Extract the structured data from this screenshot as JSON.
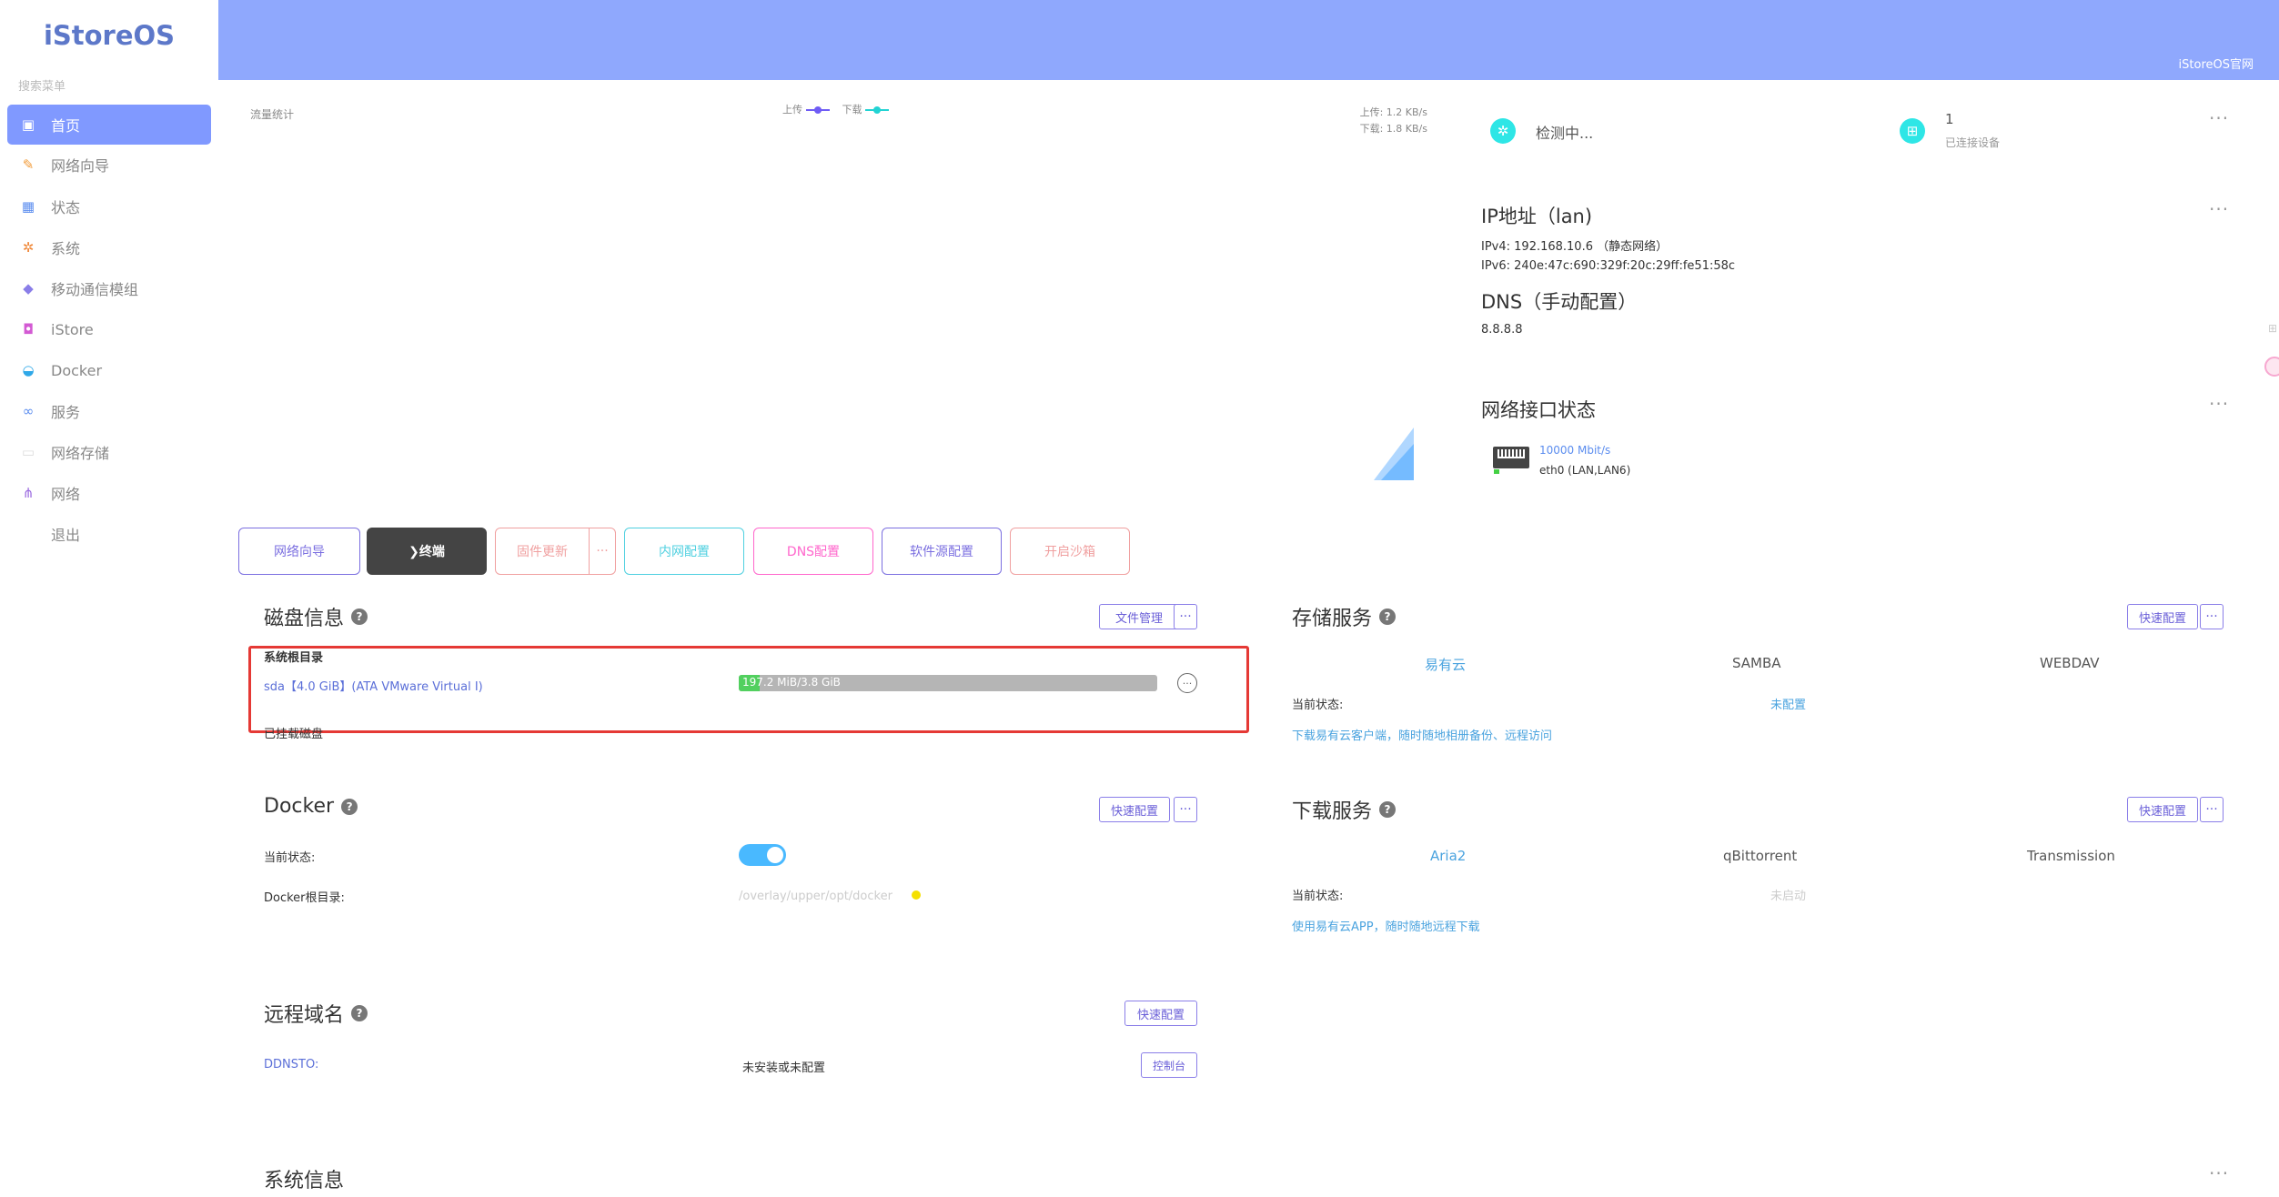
{
  "app": {
    "logo": "iStoreOS",
    "search_hint": "搜索菜单",
    "header_link": "iStoreOS官网"
  },
  "sidebar": {
    "items": [
      {
        "label": "首页",
        "icon": "home-icon",
        "active": true
      },
      {
        "label": "网络向导",
        "icon": "wizard-icon"
      },
      {
        "label": "状态",
        "icon": "dashboard-icon"
      },
      {
        "label": "系统",
        "icon": "gear-icon"
      },
      {
        "label": "移动通信模组",
        "icon": "cube-icon"
      },
      {
        "label": "iStore",
        "icon": "store-icon"
      },
      {
        "label": "Docker",
        "icon": "docker-icon"
      },
      {
        "label": "服务",
        "icon": "link-icon"
      },
      {
        "label": "网络存储",
        "icon": "storage-icon"
      },
      {
        "label": "网络",
        "icon": "network-icon"
      },
      {
        "label": "退出",
        "icon": "logout-icon"
      }
    ]
  },
  "traffic": {
    "title": "流量统计",
    "legend_up": "上传",
    "legend_down": "下载",
    "up_rate": "上传: 1.2 KB/s",
    "down_rate": "下载: 1.8 KB/s"
  },
  "status": {
    "detecting": "检测中...",
    "devices_count": "1",
    "devices_label": "已连接设备"
  },
  "ip": {
    "title": "IP地址（lan)",
    "ipv4": "IPv4: 192.168.10.6 （静态网络）",
    "ipv6": "IPv6: 240e:47c:690:329f:20c:29ff:fe51:58c",
    "dns_title": "DNS（手动配置）",
    "dns_value": "8.8.8.8"
  },
  "iface": {
    "title": "网络接口状态",
    "speed": "10000 Mbit/s",
    "name": "eth0 (LAN,LAN6)"
  },
  "quick_buttons": [
    {
      "label": "网络向导",
      "color": "#7b6fe0"
    },
    {
      "label": "❯终端",
      "color": "#444444"
    },
    {
      "label": "固件更新",
      "color": "#f0a0a0"
    },
    {
      "label": "内网配置",
      "color": "#4fd0e0"
    },
    {
      "label": "DNS配置",
      "color": "#ff66cc"
    },
    {
      "label": "软件源配置",
      "color": "#7b6fe0"
    },
    {
      "label": "开启沙箱",
      "color": "#f0a0a0"
    }
  ],
  "disk": {
    "title": "磁盘信息",
    "file_btn": "文件管理",
    "root_label": "系统根目录",
    "device": "sda【4.0 GiB】(ATA VMware Virtual I)",
    "usage_text": "197.2 MiB/3.8 GiB",
    "usage_fraction": 0.05,
    "mounted_label": "已挂载磁盘"
  },
  "storage": {
    "title": "存储服务",
    "btn": "快速配置",
    "services": [
      "易有云",
      "SAMBA",
      "WEBDAV"
    ],
    "state_label": "当前状态:",
    "state_value": "未配置",
    "tip": "下载易有云客户端，随时随地相册备份、远程访问"
  },
  "docker": {
    "title": "Docker",
    "btn": "快速配置",
    "state_label": "当前状态:",
    "root_label": "Docker根目录:",
    "root_value": "/overlay/upper/opt/docker"
  },
  "download": {
    "title": "下载服务",
    "btn": "快速配置",
    "services": [
      "Aria2",
      "qBittorrent",
      "Transmission"
    ],
    "state_label": "当前状态:",
    "state_value": "未启动",
    "tip": "使用易有云APP，随时随地远程下载"
  },
  "ddns": {
    "title": "远程域名",
    "btn": "快速配置",
    "label": "DDNSTO:",
    "value": "未安装或未配置",
    "ctrl_btn": "控制台"
  },
  "sysinfo": {
    "title": "系统信息"
  },
  "more_label": "···"
}
